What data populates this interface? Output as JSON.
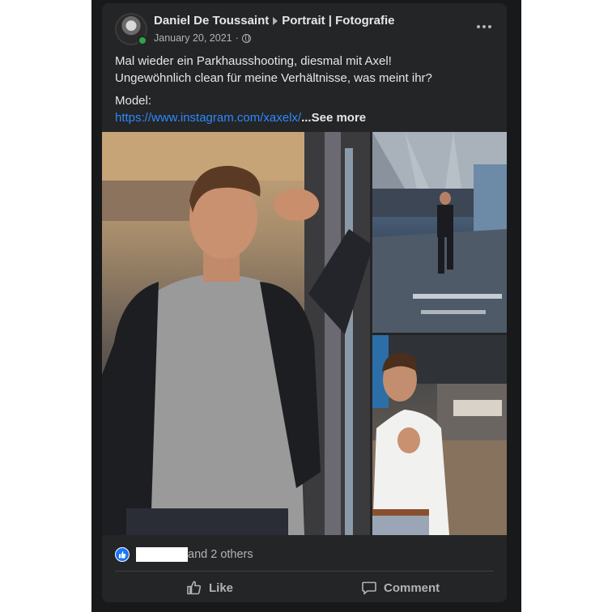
{
  "post": {
    "author": "Daniel De Toussaint",
    "page": "Portrait | Fotografie",
    "date": "January 20, 2021",
    "separator": "·",
    "audience_icon": "globe-icon",
    "menu_icon": "more-options-icon",
    "text_line1": "Mal wieder ein Parkhausshooting, diesmal mit Axel!",
    "text_line2": "Ungewöhnlich clean für meine Verhältnisse, was meint ihr?",
    "model_label": "Model:",
    "model_link": "https://www.instagram.com/xaxelx/",
    "see_more_prefix": "...",
    "see_more": "See more"
  },
  "photos": [
    {
      "icon": "photo-portrait-leather-jacket"
    },
    {
      "icon": "photo-parking-garage-walking"
    },
    {
      "icon": "photo-portrait-white-shirt"
    }
  ],
  "reactions": {
    "icon": "like-reaction-icon",
    "others_text": "and 2 others"
  },
  "actions": {
    "like_label": "Like",
    "comment_label": "Comment"
  },
  "colors": {
    "background": "#242526",
    "text": "#e4e6eb",
    "secondary_text": "#b0b3b8",
    "link": "#2d88ff",
    "like_blue": "#1877f2",
    "online_green": "#31a24c"
  }
}
